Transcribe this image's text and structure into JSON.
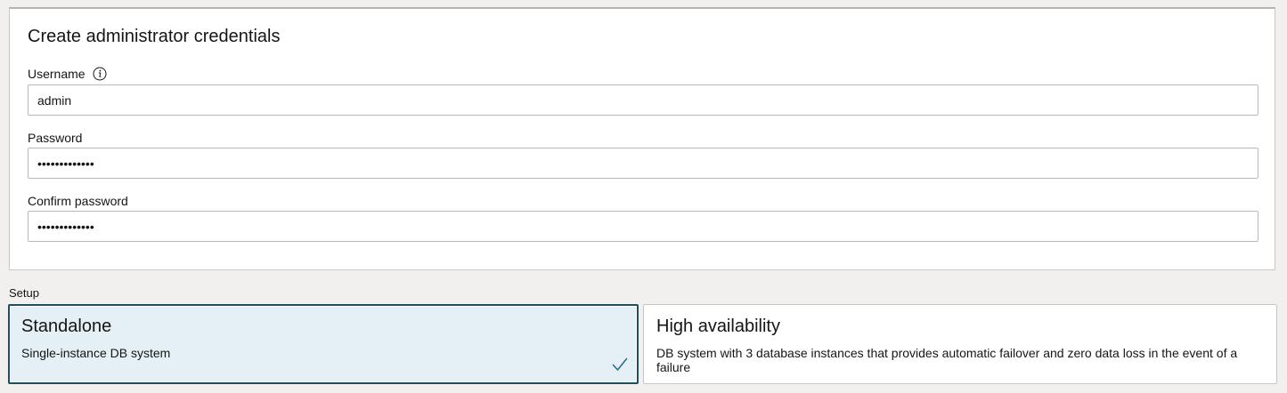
{
  "credentials": {
    "title": "Create administrator credentials",
    "username": {
      "label": "Username",
      "value": "admin",
      "info_icon": "info-icon"
    },
    "password": {
      "label": "Password",
      "value": "•••••••••••••"
    },
    "confirm_password": {
      "label": "Confirm password",
      "value": "•••••••••••••"
    }
  },
  "setup": {
    "label": "Setup",
    "options": [
      {
        "title": "Standalone",
        "description": "Single-instance DB system",
        "selected": true,
        "icon": "checkmark-icon"
      },
      {
        "title": "High availability",
        "description": "DB system with 3 database instances that provides automatic failover and zero data loss in the event of a failure",
        "selected": false
      }
    ]
  },
  "colors": {
    "selected_border": "#1f4e5e",
    "selected_background": "#e4f0f5",
    "checkmark": "#2f6f88"
  }
}
